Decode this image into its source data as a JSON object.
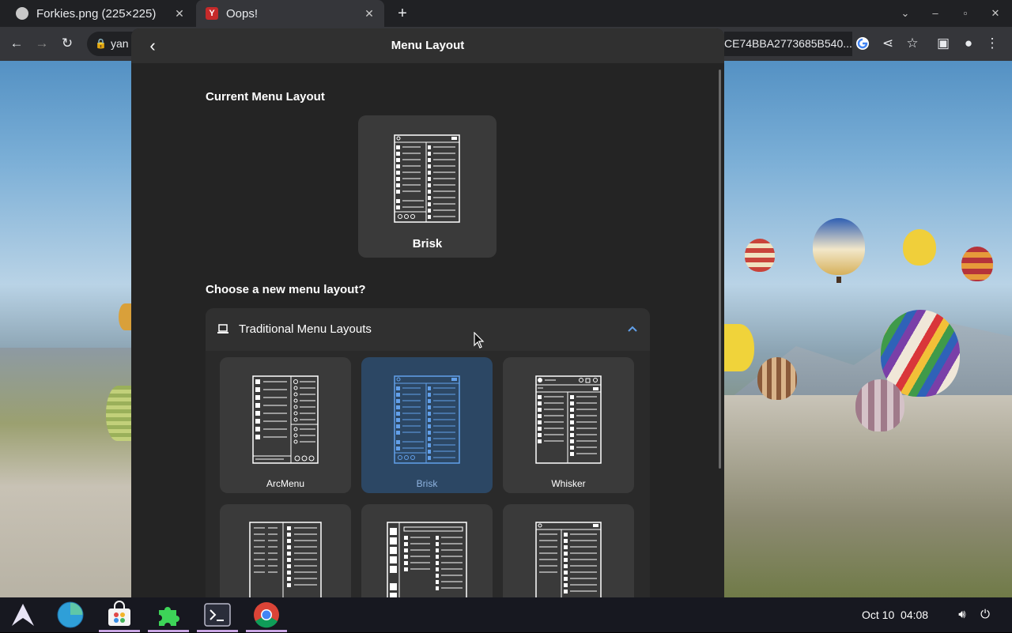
{
  "browser": {
    "tabs": [
      {
        "title": "Forkies.png (225×225)",
        "active": false
      },
      {
        "title": "Oops!",
        "active": true
      }
    ],
    "url_start": "yan",
    "url_end": "CE74BBA2773685B540..."
  },
  "dialog": {
    "title": "Menu Layout",
    "current_section": "Current Menu Layout",
    "current_layout": "Brisk",
    "choose_section": "Choose a new menu layout?",
    "category": {
      "label": "Traditional Menu Layouts",
      "expanded": true
    },
    "layouts": [
      {
        "name": "ArcMenu",
        "selected": false
      },
      {
        "name": "Brisk",
        "selected": true
      },
      {
        "name": "Whisker",
        "selected": false
      },
      {
        "name": "",
        "selected": false
      },
      {
        "name": "",
        "selected": false
      },
      {
        "name": "",
        "selected": false
      }
    ]
  },
  "taskbar": {
    "date": "Oct 10",
    "time": "04:08",
    "apps": [
      "arch-launcher",
      "browser-globe",
      "software-store",
      "extensions",
      "terminal",
      "chrome"
    ],
    "active_app": "extensions"
  },
  "colors": {
    "accent": "#62a0ea",
    "selected_card": "#2c4764",
    "dialog_bg": "#242424"
  }
}
